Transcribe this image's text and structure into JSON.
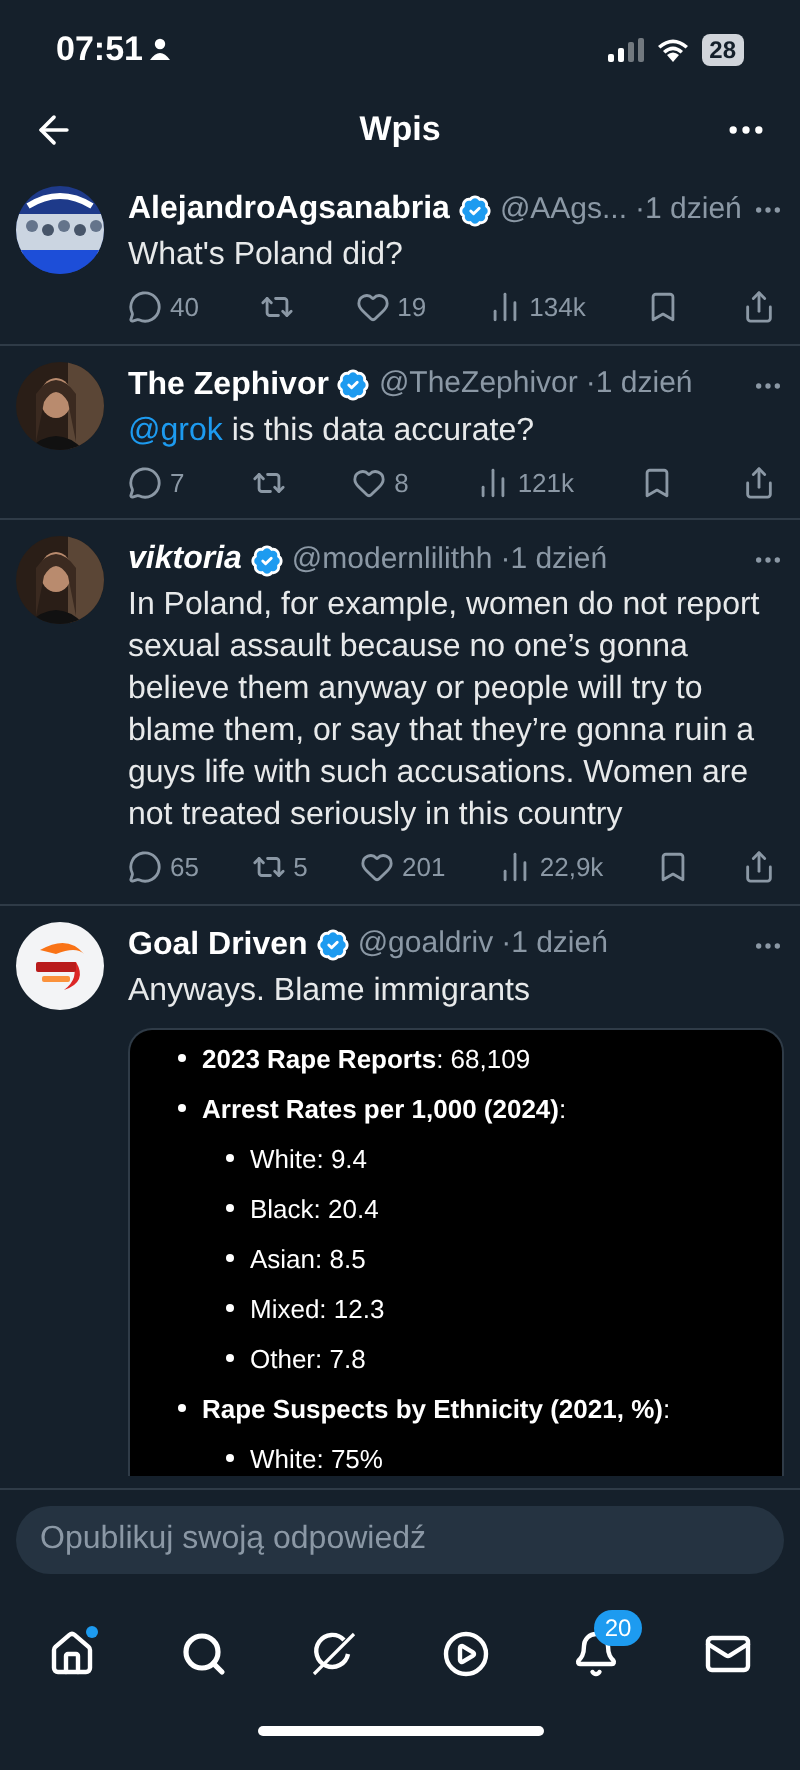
{
  "status_bar": {
    "time": "07:51",
    "battery": "28"
  },
  "header": {
    "title": "Wpis"
  },
  "tweets": [
    {
      "author": "AlejandroAgsanabria",
      "author_italic": false,
      "verified": true,
      "handle": "@AAgs...",
      "time": "·1 dzień",
      "text": [
        {
          "kind": "plain",
          "text": "What's Poland did?"
        }
      ],
      "stats": {
        "replies": "40",
        "likes": "19",
        "views": "134k"
      }
    },
    {
      "author": "The Zephivor",
      "author_italic": false,
      "verified": true,
      "handle": "@TheZephivor",
      "time": "·1 dzień",
      "text": [
        {
          "kind": "mention",
          "text": "@grok"
        },
        {
          "kind": "plain",
          "text": " is this data accurate?"
        }
      ],
      "stats": {
        "replies": "7",
        "likes": "8",
        "views": "121k"
      }
    },
    {
      "author": "viktoria",
      "author_italic": true,
      "verified": true,
      "handle": "@modernlilithh",
      "time": "·1 dzień",
      "text": [
        {
          "kind": "plain",
          "text": "In Poland, for example, women do not report sexual assault because no one’s gonna believe them anyway or people will try to blame them, or say that they’re gonna ruin a guys life with such accusations. Women are not treated seriously in this country"
        }
      ],
      "stats": {
        "replies": "65",
        "reposts": "5",
        "likes": "201",
        "views": "22,9k"
      }
    },
    {
      "author": "Goal Driven",
      "author_italic": false,
      "verified": true,
      "handle": "@goaldriv",
      "time": "·1 dzień",
      "text": [
        {
          "kind": "plain",
          "text": "Anyways. Blame immigrants"
        }
      ],
      "attachment": {
        "items": [
          {
            "text": "**2023 Rape Reports**: 68,109"
          },
          {
            "text": "**Arrest Rates per 1,000 (2024)**:",
            "children": [
              {
                "text": "White: 9.4"
              },
              {
                "text": "Black: 20.4"
              },
              {
                "text": "Asian: 8.5"
              },
              {
                "text": "Mixed: 12.3"
              },
              {
                "text": "Other: 7.8"
              }
            ]
          },
          {
            "text": "**Rape Suspects by Ethnicity (2021, %)**:",
            "children": [
              {
                "text": "White: 75%"
              }
            ]
          }
        ]
      }
    }
  ],
  "composer": {
    "placeholder": "Opublikuj swoją odpowiedź"
  },
  "nav": [
    {
      "kind": "home",
      "dot": true
    },
    {
      "kind": "search"
    },
    {
      "kind": "grok"
    },
    {
      "kind": "video"
    },
    {
      "kind": "notifications",
      "badge": "20"
    },
    {
      "kind": "messages"
    }
  ]
}
